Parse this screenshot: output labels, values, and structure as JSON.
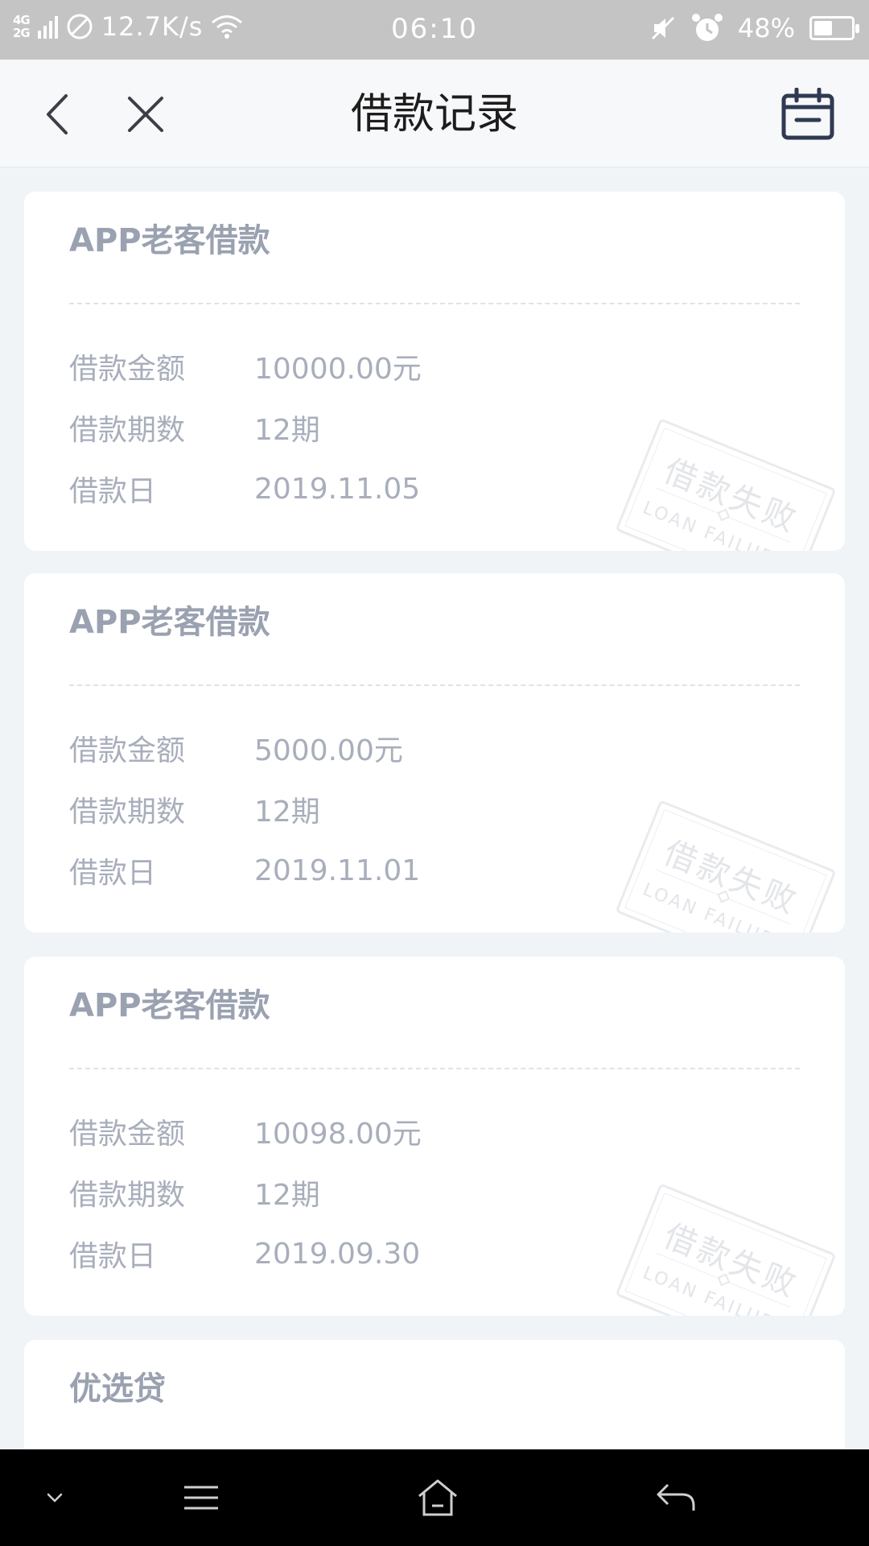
{
  "status_bar": {
    "network_top": "4G",
    "network_bottom": "2G",
    "speed": "12.7K/s",
    "time": "06:10",
    "battery": "48%",
    "battery_level": 0.48
  },
  "nav": {
    "title": "借款记录"
  },
  "records": [
    {
      "title": "APP老客借款",
      "amount_label": "借款金额",
      "amount": "10000.00元",
      "term_label": "借款期数",
      "term": "12期",
      "date_label": "借款日",
      "date": "2019.11.05",
      "stamp_cn": "借款失败",
      "stamp_en": "LOAN FAILURE"
    },
    {
      "title": "APP老客借款",
      "amount_label": "借款金额",
      "amount": "5000.00元",
      "term_label": "借款期数",
      "term": "12期",
      "date_label": "借款日",
      "date": "2019.11.01",
      "stamp_cn": "借款失败",
      "stamp_en": "LOAN FAILURE"
    },
    {
      "title": "APP老客借款",
      "amount_label": "借款金额",
      "amount": "10098.00元",
      "term_label": "借款期数",
      "term": "12期",
      "date_label": "借款日",
      "date": "2019.09.30",
      "stamp_cn": "借款失败",
      "stamp_en": "LOAN FAILURE"
    },
    {
      "title": "优选贷"
    }
  ],
  "icons": {
    "back": "chevron-left-icon",
    "close": "close-icon",
    "calendar": "calendar-icon",
    "sys_collapse": "chevron-down-icon",
    "sys_menu": "menu-icon",
    "sys_home": "home-icon",
    "sys_back": "back-arrow-icon"
  },
  "colors": {
    "page_bg": "#f1f4f7",
    "card_bg": "#ffffff",
    "text_muted": "#a8aebb",
    "title_muted": "#9aa1b0",
    "nav_text": "#1d1d1d",
    "status_bar_bg": "#c4c4c4"
  }
}
